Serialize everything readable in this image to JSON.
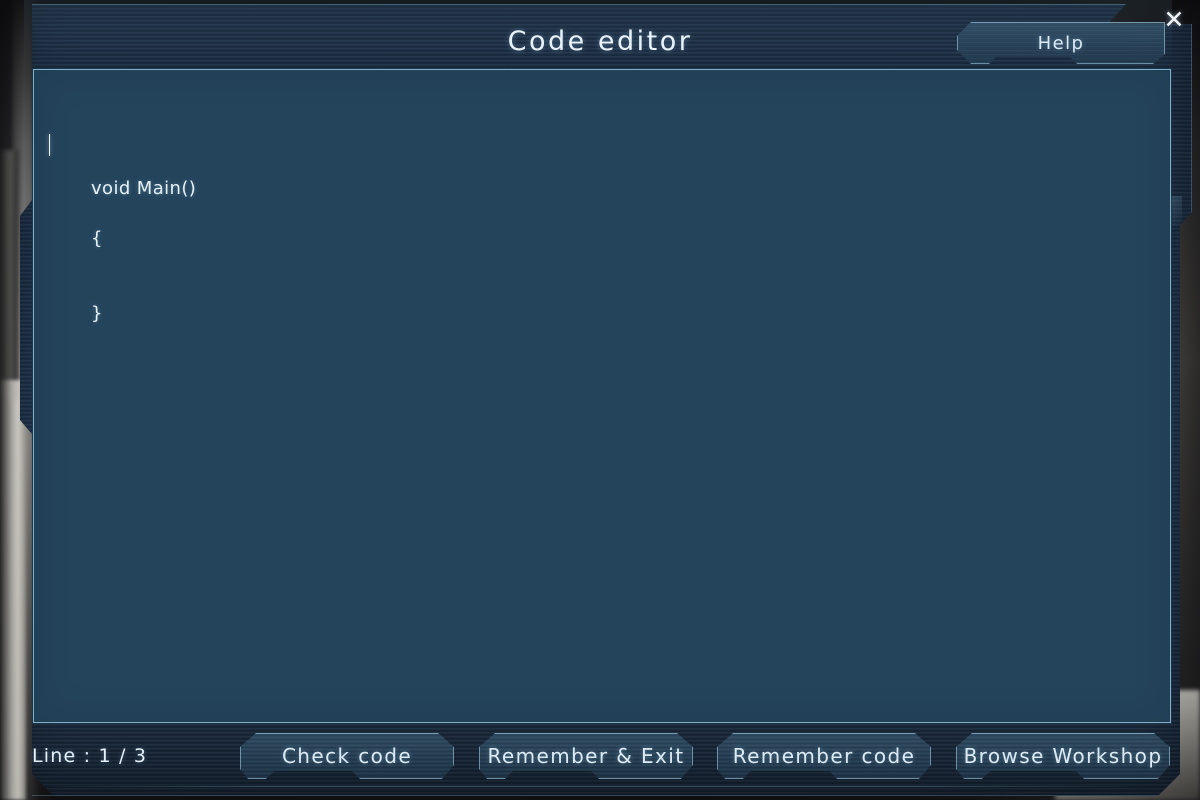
{
  "window": {
    "title": "Code editor",
    "close_icon": "close-x-icon"
  },
  "header": {
    "help_label": "Help"
  },
  "editor": {
    "code_lines": [
      "void Main()",
      "{",
      "}"
    ],
    "caret_line": 1,
    "caret_column": 1
  },
  "status": {
    "line_label": "Line : 1 / 3"
  },
  "footer": {
    "buttons": [
      {
        "id": "check-code",
        "label": "Check code"
      },
      {
        "id": "remember-exit",
        "label": "Remember & Exit"
      },
      {
        "id": "remember-code",
        "label": "Remember code"
      },
      {
        "id": "browse-workshop",
        "label": "Browse Workshop"
      }
    ]
  },
  "colors": {
    "panel_fill": "#24445c",
    "panel_border": "#7fb0c8",
    "frame_dark": "#1b2c41",
    "text_light": "#e6f1f8",
    "accent_glow": "#8cc8f0"
  }
}
